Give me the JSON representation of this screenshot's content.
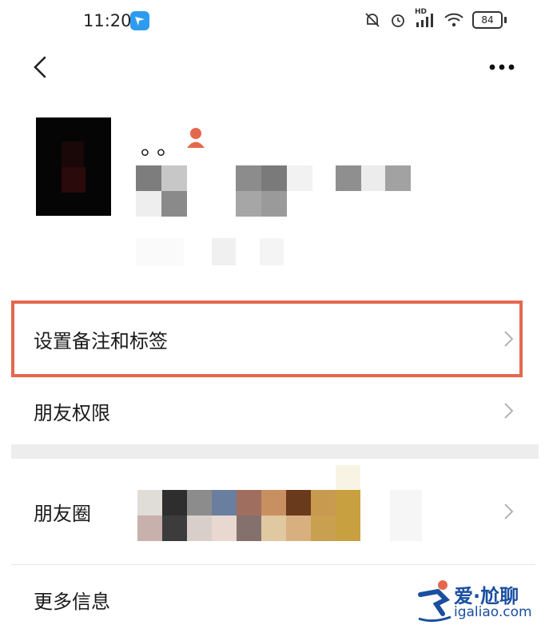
{
  "status_bar": {
    "time": "11:20",
    "battery": "84",
    "network_badge": "HD"
  },
  "nav": {
    "back_icon": "back-chevron-icon",
    "more_icon": "more-dots-icon"
  },
  "profile": {
    "nickname": "。。"
  },
  "menu": {
    "set_remark": "设置备注和标签",
    "friend_permissions": "朋友权限",
    "moments": "朋友圈",
    "more_info": "更多信息"
  },
  "watermark": {
    "line1": "爱·尬聊",
    "line2": "igaliao.com"
  },
  "colors": {
    "highlight_border": "#e4684e",
    "accent_badge": "#2d9cf0",
    "person_icon": "#e4684e"
  }
}
